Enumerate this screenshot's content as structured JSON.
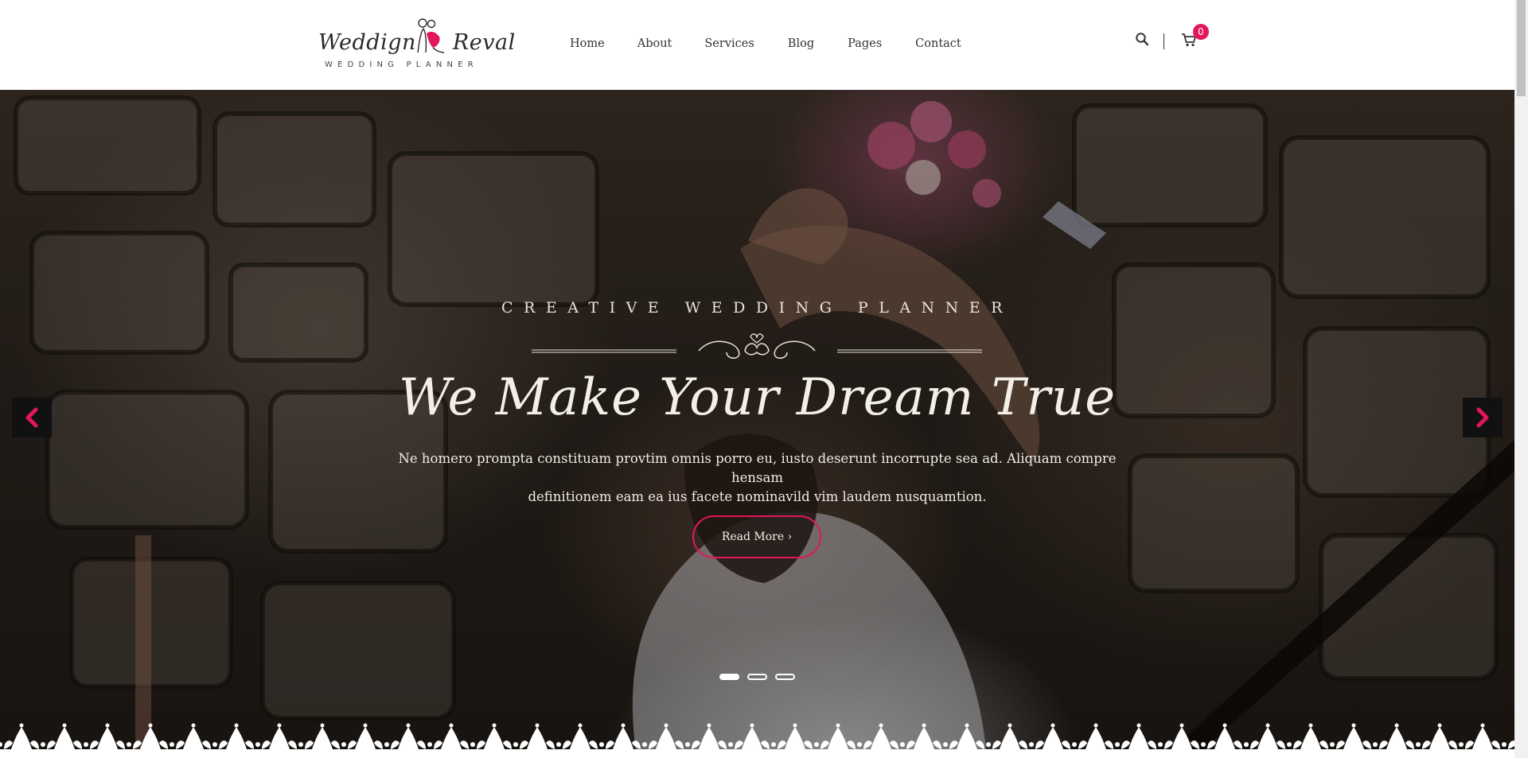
{
  "brand": {
    "name_left": "Weddign",
    "name_right": "Reval",
    "tagline": "WEDDING PLANNER",
    "logo_icon": "couple-icon"
  },
  "nav": {
    "items": [
      {
        "label": "Home"
      },
      {
        "label": "About"
      },
      {
        "label": "Services"
      },
      {
        "label": "Blog"
      },
      {
        "label": "Pages"
      },
      {
        "label": "Contact"
      }
    ]
  },
  "header_actions": {
    "search_icon": "search-icon",
    "cart_icon": "cart-icon",
    "cart_count": "0"
  },
  "hero": {
    "kicker": "CREATIVE WEDDING PLANNER",
    "headline": "We Make Your Dream True",
    "intro_line1": "Ne homero prompta constituam provtim omnis porro eu, iusto deserunt incorrupte sea ad. Aliquam compre hensam",
    "intro_line2": "definitionem eam ea ius facete nominavild vim laudem nusquamtion.",
    "button_label": "Read More ›",
    "slides_total": 3,
    "active_slide": 1
  },
  "colors": {
    "accent": "#e2175a",
    "header_bg": "#ffffff",
    "text_dark": "#333333",
    "hero_text": "#f4eee8"
  }
}
